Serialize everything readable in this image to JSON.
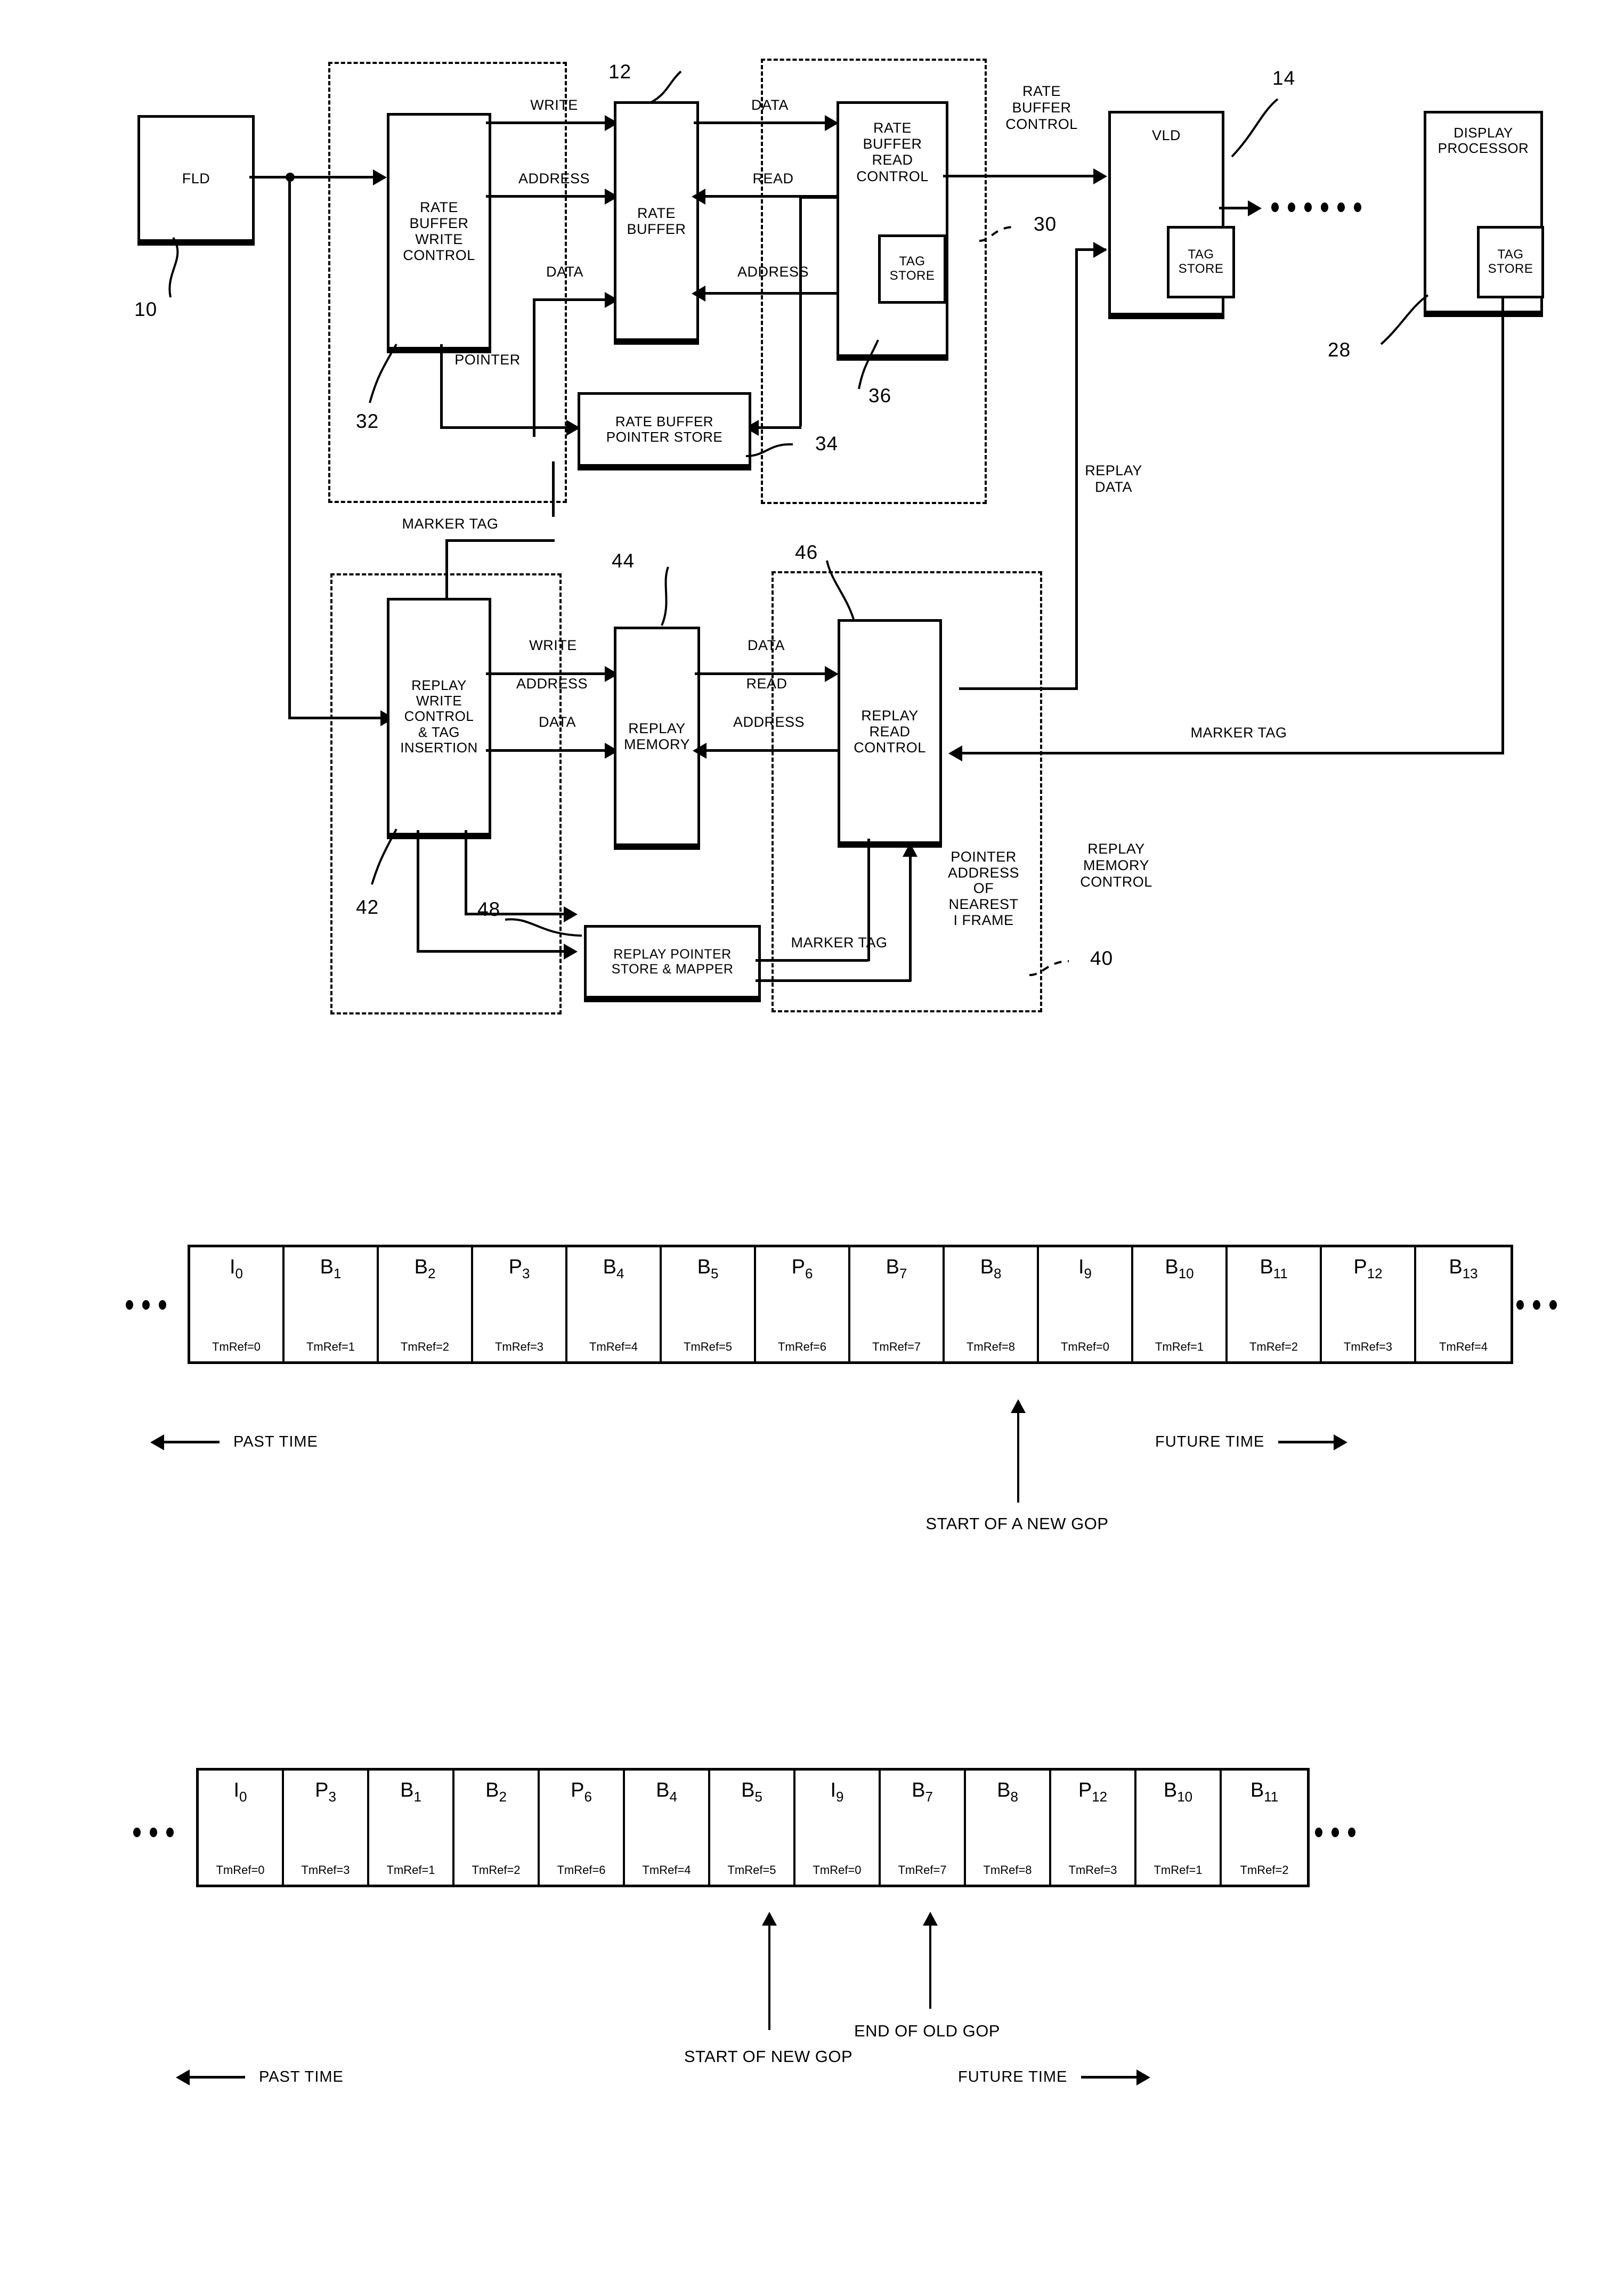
{
  "figure1": {
    "blocks": {
      "fld": "FLD",
      "rate_buffer_write_control": "RATE\nBUFFER\nWRITE\nCONTROL",
      "rate_buffer": "RATE\nBUFFER",
      "rate_buffer_read_control": "RATE\nBUFFER\nREAD\nCONTROL",
      "tag_store_rbrc": "TAG\nSTORE",
      "rate_buffer_pointer_store": "RATE BUFFER\nPOINTER STORE",
      "vld": "VLD",
      "tag_store_vld": "TAG\nSTORE",
      "display_processor": "DISPLAY\nPROCESSOR",
      "tag_store_dp": "TAG\nSTORE",
      "replay_write_control": "REPLAY\nWRITE\nCONTROL\n& TAG\nINSERTION",
      "replay_memory": "REPLAY\nMEMORY",
      "replay_read_control": "REPLAY\nREAD\nCONTROL",
      "replay_pointer_store": "REPLAY POINTER\nSTORE & MAPPER"
    },
    "signals": {
      "write_top": "WRITE",
      "address_top": "ADDRESS",
      "data_top_left": "DATA",
      "data_rb_out": "DATA",
      "read_top": "READ",
      "address_rb_read": "ADDRESS",
      "pointer": "POINTER",
      "rate_buffer_control": "RATE\nBUFFER\nCONTROL",
      "marker_tag_upper": "MARKER TAG",
      "replay_data": "REPLAY\nDATA",
      "write_lower": "WRITE",
      "address_lower": "ADDRESS",
      "data_lower": "DATA",
      "data_rm_out": "DATA",
      "read_lower": "READ",
      "address_rr": "ADDRESS",
      "marker_tag_right": "MARKER TAG",
      "marker_tag_lower": "MARKER TAG",
      "pointer_address_of_nearest_i_frame": "POINTER\nADDRESS\nOF\nNEAREST\nI FRAME",
      "replay_memory_control": "REPLAY\nMEMORY\nCONTROL"
    },
    "ref_numerals": {
      "n10": "10",
      "n12": "12",
      "n14": "14",
      "n28": "28",
      "n30": "30",
      "n32": "32",
      "n34": "34",
      "n36": "36",
      "n40": "40",
      "n42": "42",
      "n44": "44",
      "n46": "46",
      "n48": "48"
    }
  },
  "chart_data": [
    {
      "type": "table",
      "name": "display-order-gop-sequence",
      "title": "",
      "columns": [
        "frame",
        "time_reference"
      ],
      "leading_ellipsis": true,
      "trailing_ellipsis": true,
      "frames": [
        {
          "type": "I",
          "index": "0",
          "tmref": "TmRef=0"
        },
        {
          "type": "B",
          "index": "1",
          "tmref": "TmRef=1"
        },
        {
          "type": "B",
          "index": "2",
          "tmref": "TmRef=2"
        },
        {
          "type": "P",
          "index": "3",
          "tmref": "TmRef=3"
        },
        {
          "type": "B",
          "index": "4",
          "tmref": "TmRef=4"
        },
        {
          "type": "B",
          "index": "5",
          "tmref": "TmRef=5"
        },
        {
          "type": "P",
          "index": "6",
          "tmref": "TmRef=6"
        },
        {
          "type": "B",
          "index": "7",
          "tmref": "TmRef=7"
        },
        {
          "type": "B",
          "index": "8",
          "tmref": "TmRef=8"
        },
        {
          "type": "I",
          "index": "9",
          "tmref": "TmRef=0"
        },
        {
          "type": "B",
          "index": "10",
          "tmref": "TmRef=1"
        },
        {
          "type": "B",
          "index": "11",
          "tmref": "TmRef=2"
        },
        {
          "type": "P",
          "index": "12",
          "tmref": "TmRef=3"
        },
        {
          "type": "B",
          "index": "13",
          "tmref": "TmRef=4"
        }
      ],
      "annotations": [
        {
          "label": "START OF A NEW GOP",
          "points_to_frame_index": 9
        }
      ],
      "axis_labels": {
        "left": "PAST TIME",
        "right": "FUTURE TIME"
      }
    },
    {
      "type": "table",
      "name": "transmission-order-gop-sequence",
      "title": "",
      "columns": [
        "frame",
        "time_reference"
      ],
      "leading_ellipsis": true,
      "trailing_ellipsis": true,
      "frames": [
        {
          "type": "I",
          "index": "0",
          "tmref": "TmRef=0"
        },
        {
          "type": "P",
          "index": "3",
          "tmref": "TmRef=3"
        },
        {
          "type": "B",
          "index": "1",
          "tmref": "TmRef=1"
        },
        {
          "type": "B",
          "index": "2",
          "tmref": "TmRef=2"
        },
        {
          "type": "P",
          "index": "6",
          "tmref": "TmRef=6"
        },
        {
          "type": "B",
          "index": "4",
          "tmref": "TmRef=4"
        },
        {
          "type": "B",
          "index": "5",
          "tmref": "TmRef=5"
        },
        {
          "type": "I",
          "index": "9",
          "tmref": "TmRef=0"
        },
        {
          "type": "B",
          "index": "7",
          "tmref": "TmRef=7"
        },
        {
          "type": "B",
          "index": "8",
          "tmref": "TmRef=8"
        },
        {
          "type": "P",
          "index": "12",
          "tmref": "TmRef=3"
        },
        {
          "type": "B",
          "index": "10",
          "tmref": "TmRef=1"
        },
        {
          "type": "B",
          "index": "11",
          "tmref": "TmRef=2"
        }
      ],
      "annotations": [
        {
          "label": "START OF NEW GOP",
          "points_to_frame_index": 7
        },
        {
          "label": "END OF OLD GOP",
          "points_to_frame_index": 9
        }
      ],
      "axis_labels": {
        "left": "PAST TIME",
        "right": "FUTURE TIME"
      }
    }
  ]
}
